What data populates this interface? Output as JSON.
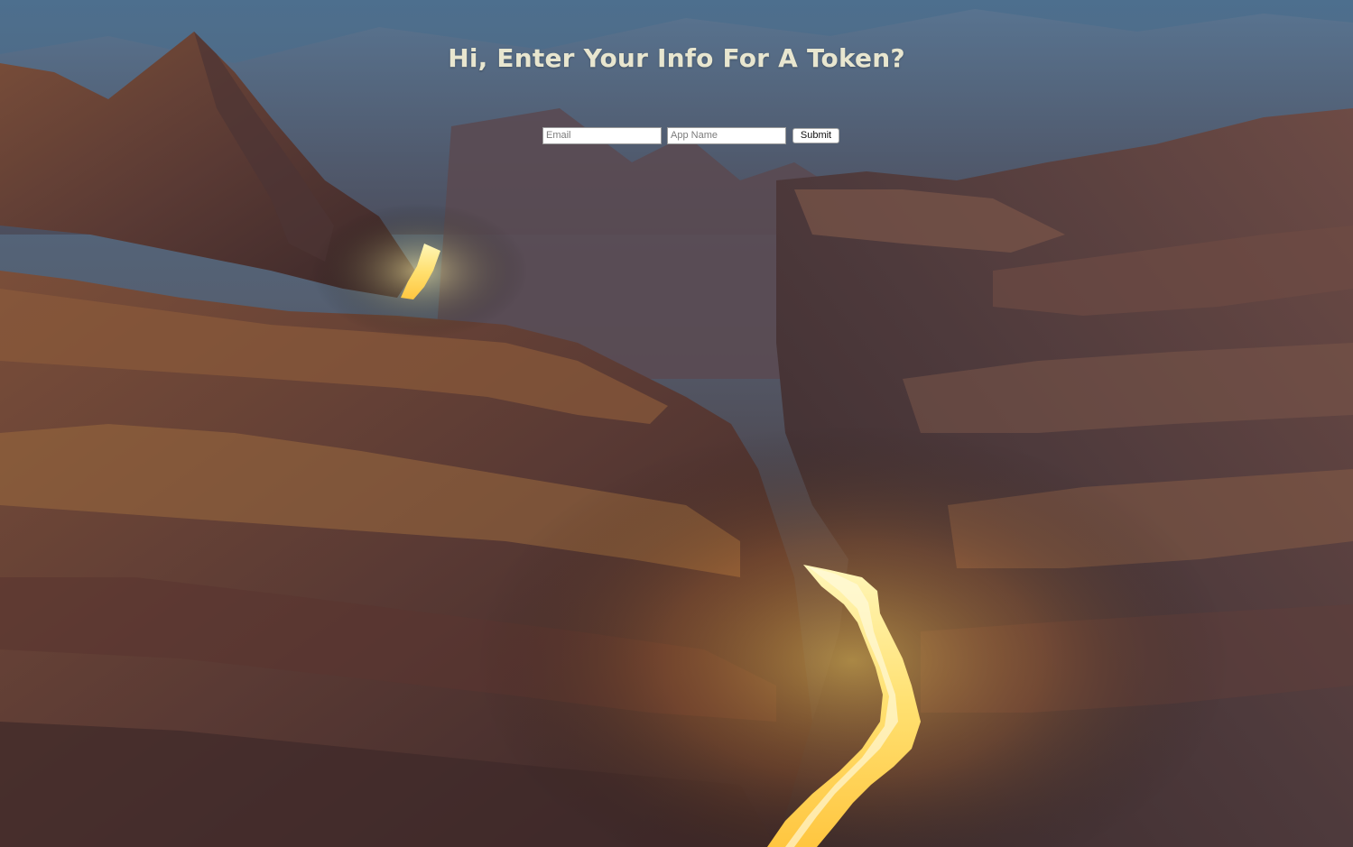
{
  "page": {
    "heading": "Hi, Enter Your Info For A Token?"
  },
  "form": {
    "email_placeholder": "Email",
    "email_value": "",
    "app_name_placeholder": "App Name",
    "app_name_value": "",
    "submit_label": "Submit"
  },
  "background": {
    "subject": "aerial canyon with glowing river",
    "colors": {
      "sky_haze": "#5c7d98",
      "rock_dark": "#3a2a2b",
      "rock_mid": "#6b4636",
      "rock_light": "#a06a3c",
      "river_glow": "#ffd860"
    }
  }
}
